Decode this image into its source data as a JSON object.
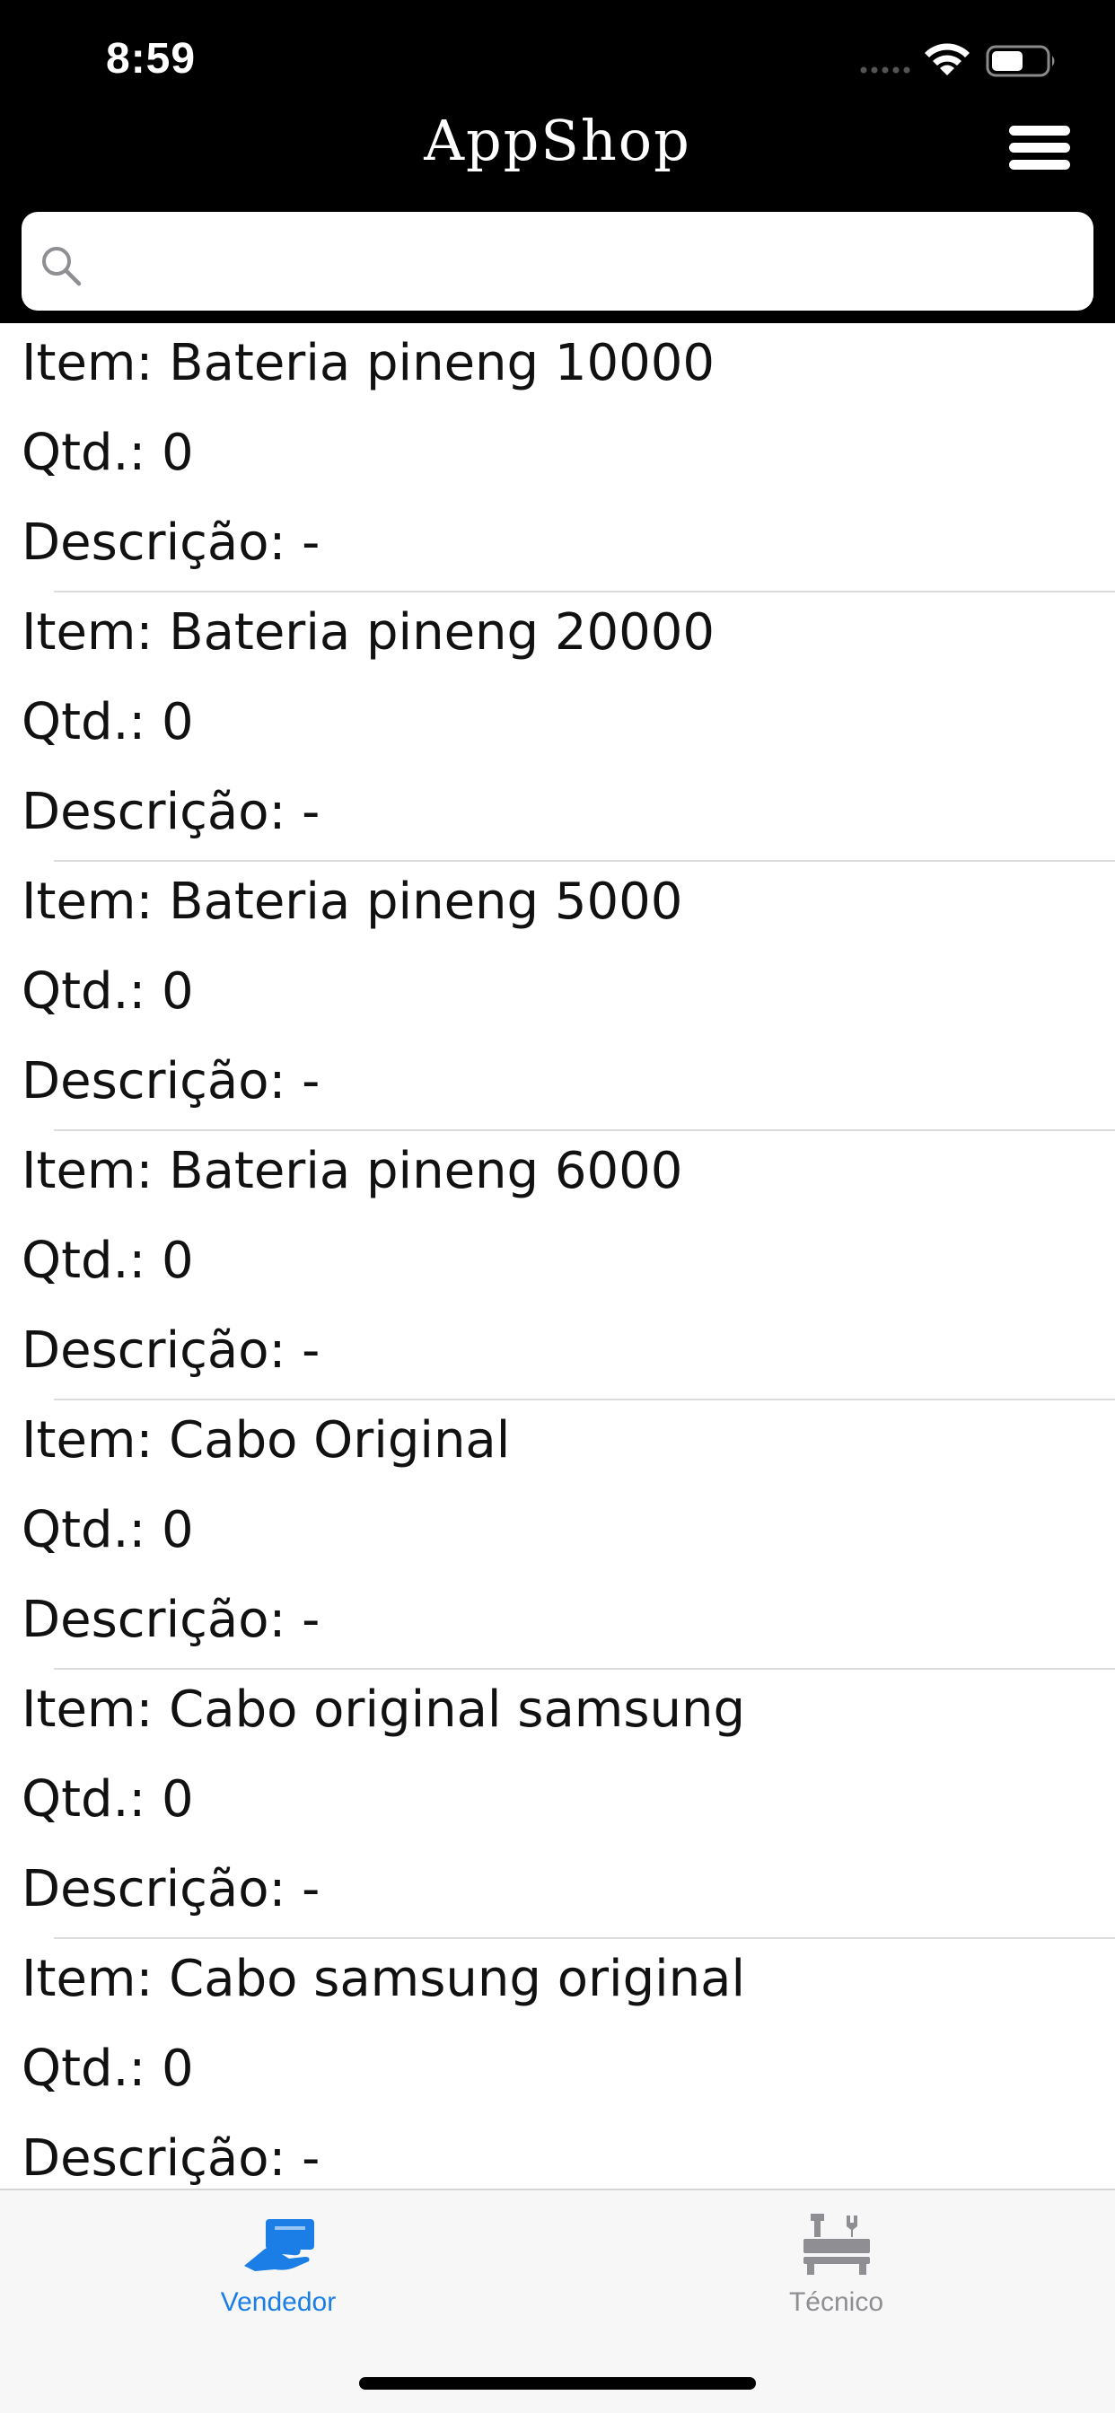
{
  "status_bar": {
    "time": "8:59"
  },
  "nav": {
    "title": "AppShop",
    "menu_icon": "hamburger-menu-icon"
  },
  "search": {
    "value": "",
    "placeholder": "",
    "icon": "search-icon"
  },
  "items": [
    {
      "name": "Item: Bateria pineng 10000",
      "qty": "Qtd.: 0",
      "desc": "Descrição: -"
    },
    {
      "name": "Item: Bateria pineng 20000",
      "qty": "Qtd.: 0",
      "desc": "Descrição: -"
    },
    {
      "name": "Item: Bateria pineng 5000",
      "qty": "Qtd.: 0",
      "desc": "Descrição: -"
    },
    {
      "name": "Item: Bateria pineng 6000",
      "qty": "Qtd.: 0",
      "desc": "Descrição: -"
    },
    {
      "name": "Item: Cabo Original",
      "qty": "Qtd.: 0",
      "desc": "Descrição: -"
    },
    {
      "name": "Item: Cabo original samsung",
      "qty": "Qtd.: 0",
      "desc": "Descrição: -"
    },
    {
      "name": "Item: Cabo samsung original",
      "qty": "Qtd.: 0",
      "desc": "Descrição: -"
    }
  ],
  "tabs": [
    {
      "label": "Vendedor",
      "icon": "seller-hand-icon",
      "selected": true
    },
    {
      "label": "Técnico",
      "icon": "technician-toolbox-icon",
      "selected": false
    }
  ],
  "colors": {
    "header_bg": "#000000",
    "accent": "#1a7ee6",
    "inactive_tab": "#8e8e93",
    "tab_bar_bg": "#f7f7f7",
    "divider": "#dcdcdc"
  }
}
